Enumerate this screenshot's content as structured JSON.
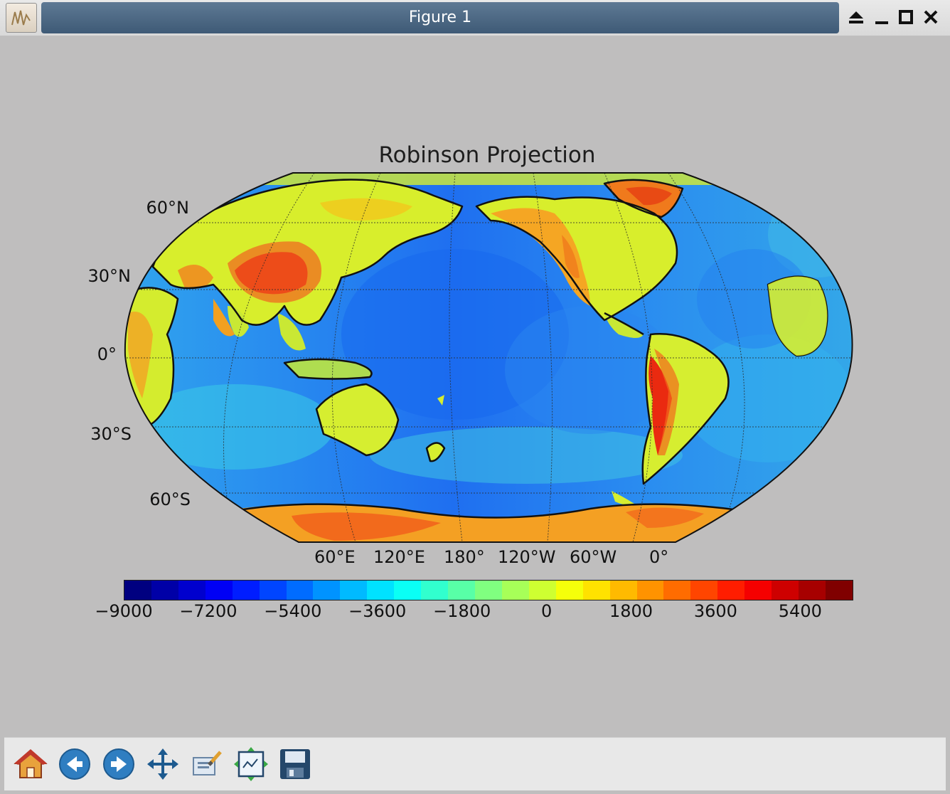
{
  "window": {
    "title": "Figure 1",
    "controls": [
      "eject-icon",
      "minimize-icon",
      "maximize-icon",
      "close-icon"
    ]
  },
  "figure": {
    "title": "Robinson Projection",
    "lat_labels": [
      "60°N",
      "30°N",
      "0°",
      "30°S",
      "60°S"
    ],
    "lon_labels": [
      "60°E",
      "120°E",
      "180°",
      "120°W",
      "60°W",
      "0°"
    ],
    "colormap": "jet",
    "colorbar_ticks": [
      "−9000",
      "−7200",
      "−5400",
      "−3600",
      "−1800",
      "0",
      "1800",
      "3600",
      "5400"
    ],
    "colorbar_range": [
      -9000,
      6500
    ]
  },
  "toolbar": {
    "buttons": [
      {
        "name": "home-button",
        "icon": "home-icon"
      },
      {
        "name": "back-button",
        "icon": "back-arrow-icon"
      },
      {
        "name": "forward-button",
        "icon": "forward-arrow-icon"
      },
      {
        "name": "pan-button",
        "icon": "pan-arrows-icon"
      },
      {
        "name": "zoom-button",
        "icon": "zoom-rect-icon"
      },
      {
        "name": "subplots-button",
        "icon": "subplots-icon"
      },
      {
        "name": "save-button",
        "icon": "floppy-disk-icon"
      }
    ]
  }
}
